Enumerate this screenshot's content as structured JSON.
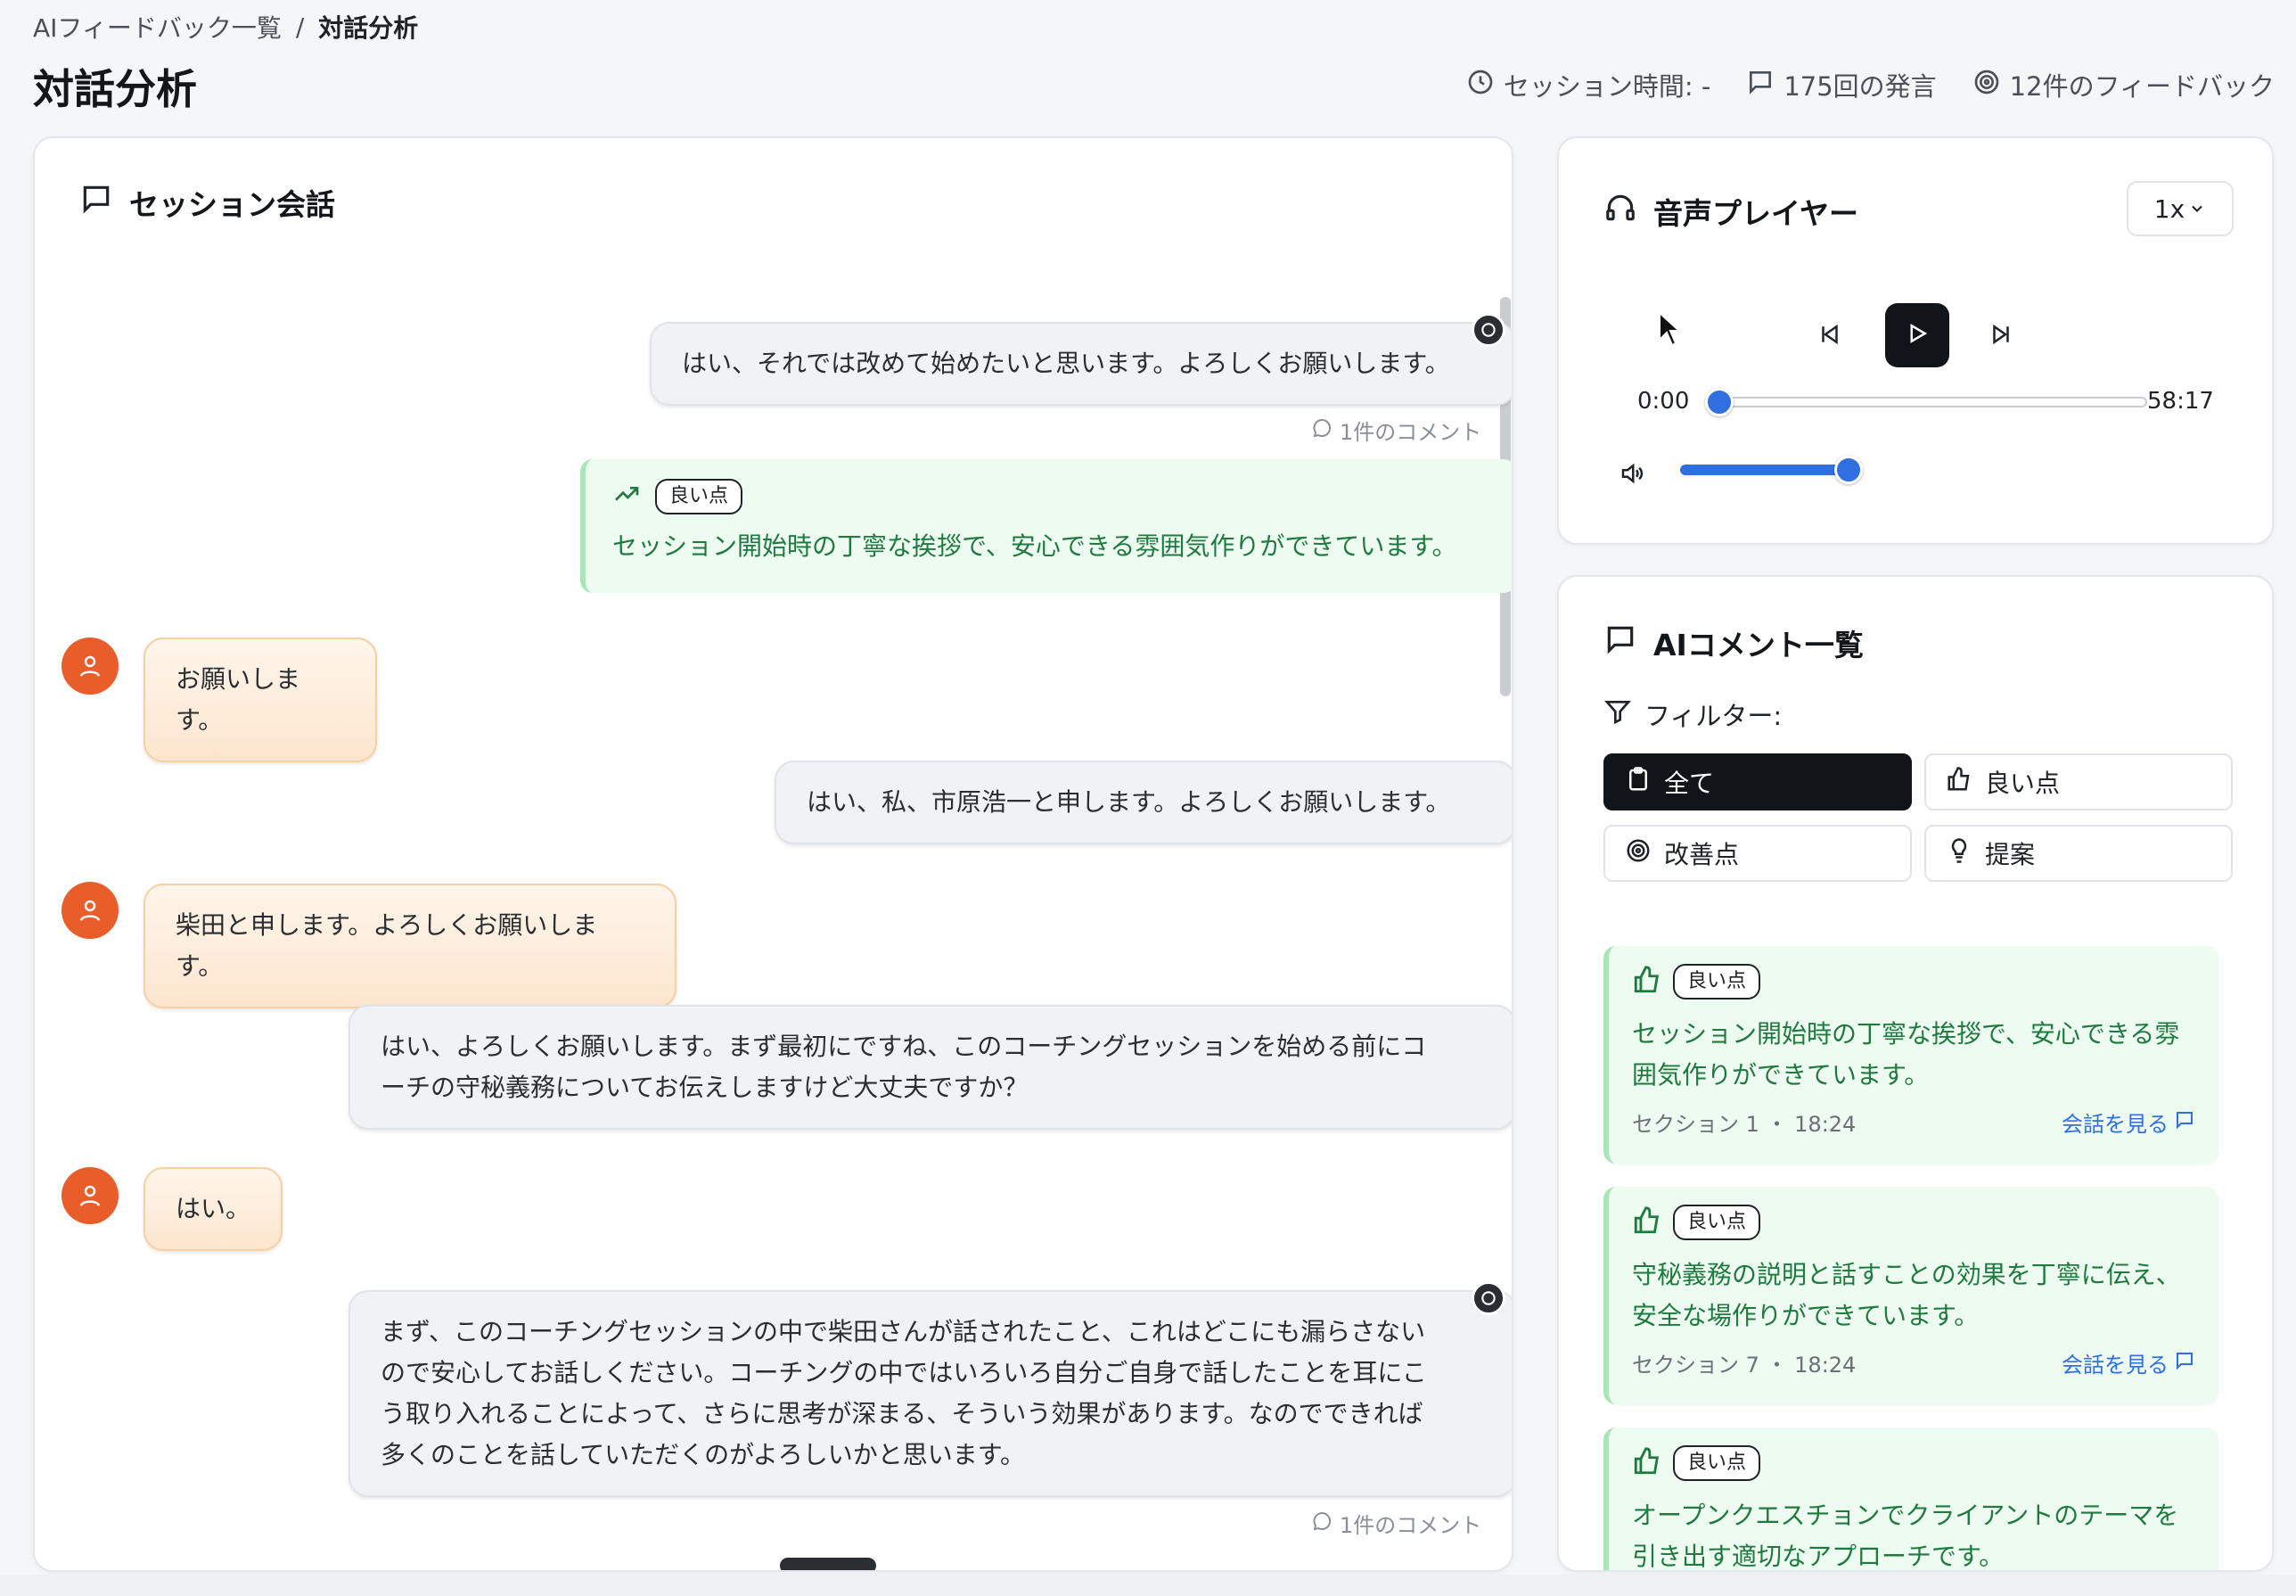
{
  "breadcrumb": {
    "parent": "AIフィードバック一覧",
    "separator": "/",
    "current": "対話分析"
  },
  "page_title": "対話分析",
  "stats": {
    "session_time": "セッション時間: -",
    "utterances": "175回の発言",
    "feedback_count": "12件のフィードバック"
  },
  "conversation": {
    "title": "セッション会話",
    "messages": [
      {
        "speaker": "coach",
        "text": "はい、それでは改めて始めたいと思います。よろしくお願いします。",
        "comment_count": "1件のコメント"
      },
      {
        "speaker": "client",
        "text": "お願いします。"
      },
      {
        "speaker": "coach",
        "text": "はい、私、市原浩一と申します。よろしくお願いします。"
      },
      {
        "speaker": "client",
        "text": "柴田と申します。よろしくお願いします。"
      },
      {
        "speaker": "coach",
        "text_line1": "はい、よろしくお願いします。まず最初にですね、このコーチングセッションを始める前にコ",
        "text_line2": "ーチの守秘義務についてお伝えしますけど大丈夫ですか？"
      },
      {
        "speaker": "client",
        "text": "はい。"
      },
      {
        "speaker": "coach",
        "text_line1": "まず、このコーチングセッションの中で柴田さんが話されたこと、これはどこにも漏らさない",
        "text_line2": "ので安心してお話しください。コーチングの中ではいろいろ自分ご自身で話したことを耳にこ",
        "text_line3": "う取り入れることによって、さらに思考が深まる、そういう効果があります。なのでできれば",
        "text_line4": "多くのことを話していただくのがよろしいかと思います。",
        "comment_count": "1件のコメント"
      }
    ],
    "inline_feedback": {
      "tag": "良い点",
      "text": "セッション開始時の丁寧な挨拶で、安心できる雰囲気作りができています。",
      "icon": "trending-up-icon"
    }
  },
  "player": {
    "title": "音声プレイヤー",
    "speed": "1x",
    "current_time": "0:00",
    "duration": "58:17",
    "progress": 0.0,
    "volume": 0.9
  },
  "comments": {
    "title": "AIコメント一覧",
    "filter_label": "フィルター:",
    "filters": [
      {
        "label": "全て",
        "icon": "clipboard-icon",
        "active": true
      },
      {
        "label": "良い点",
        "icon": "thumbs-up-icon",
        "active": false
      },
      {
        "label": "改善点",
        "icon": "target-icon",
        "active": false
      },
      {
        "label": "提案",
        "icon": "lightbulb-icon",
        "active": false
      }
    ],
    "cards": [
      {
        "tag": "良い点",
        "text_line1": "セッション開始時の丁寧な挨拶で、安心できる雰",
        "text_line2": "囲気作りができています。",
        "section": "セクション 1 ・ 18:24",
        "link": "会話を見る"
      },
      {
        "tag": "良い点",
        "text_line1": "守秘義務の説明と話すことの効果を丁寧に伝え、",
        "text_line2": "安全な場作りができています。",
        "section": "セクション 7 ・ 18:24",
        "link": "会話を見る"
      },
      {
        "tag": "良い点",
        "text_line1": "オープンクエスチョンでクライアントのテーマを",
        "text_line2": "引き出す適切なアプローチです。"
      }
    ]
  },
  "colors": {
    "accent_blue": "#2f6fdf",
    "client_avatar": "#e85d2a",
    "positive_green": "#1e7a3f"
  }
}
